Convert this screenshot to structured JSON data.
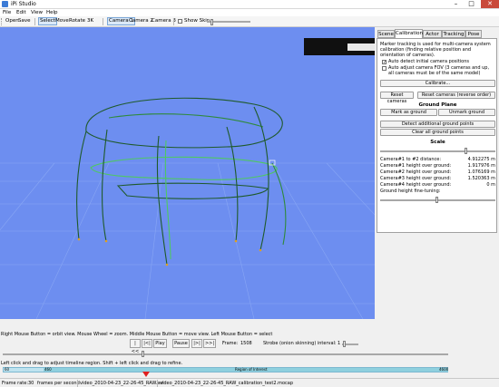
{
  "window": {
    "title": "iPi Studio",
    "minimize": "–",
    "maximize": "□",
    "close": "✕"
  },
  "menu": [
    "File",
    "Edit",
    "View",
    "Help"
  ],
  "toolbar": {
    "open": "Open",
    "save": "Save",
    "select": "Select",
    "move": "Move",
    "rotate": "Rotate",
    "zoom_value": "3K",
    "cameras": [
      "Camera 1",
      "Camera 2",
      "Camera 3"
    ],
    "show_skin": "Show Skin"
  },
  "tabs": [
    "Scene",
    "Calibration",
    "Actor",
    "Tracking",
    "Pose"
  ],
  "calibration": {
    "description": "Marker tracking is used for multi-camera system calibration (finding relative position and orientation of cameras).",
    "auto_detect": "Auto detect initial camera positions",
    "auto_adjust": "Auto adjust camera FOV (3 cameras and up, all cameras must be of the same model)",
    "calibrate_btn": "Calibrate...",
    "reset_cameras_btn": "Reset cameras",
    "reset_reverse_btn": "Reset cameras (reverse order)",
    "ground_plane_hdr": "Ground Plane",
    "mark_ground_btn": "Mark as ground",
    "unmark_ground_btn": "Unmark ground",
    "detect_ground_btn": "Detect additional ground points",
    "clear_ground_btn": "Clear all ground points",
    "scale_hdr": "Scale",
    "distance_label": "Camera#1 to #2 distance:",
    "distance_value": "4.912275 m",
    "h1_label": "Camera#1 height over ground:",
    "h1_value": "1.917976 m",
    "h2_label": "Camera#2 height over ground:",
    "h2_value": "1.076169 m",
    "h3_label": "Camera#3 height over ground:",
    "h3_value": "1.520363 m",
    "h4_label": "Camera#4 height over ground:",
    "h4_value": "0 m",
    "fine_tune_label": "Ground height fine-tuning:"
  },
  "bottom": {
    "mouse_help": "Right Mouse Button = orbit view. Mouse Wheel = zoom. Middle Mouse Button = move view. Left Mouse Button = select",
    "play_buttons": [
      "|<<",
      "|<|",
      "Play",
      "Pause",
      "|>|",
      ">>|"
    ],
    "frame_label": "Frame:",
    "frame_value": "1508",
    "strobe_label": "Strobe (onion skinning) interval:",
    "strobe_value": "1",
    "timeline_help": "Left click and drag to adjust timeline region. Shift + left click and drag to refine.",
    "tl_start": "60",
    "tl_region_start": "460",
    "tl_region_label": "Region of Interest",
    "tl_end": "4600",
    "playhead_progress": 0.325
  },
  "status": {
    "frame_rate_label": "Frame rate:",
    "frame_rate_value": "30",
    "fps_label": "frames per second",
    "file1": "video_2010-04-23_22-26-45_RAW.avi",
    "file2": "video_2010-04-23_22-26-45_RAW_calibration_test2.mocap"
  },
  "colors": {
    "viewport": "#6d8ef0",
    "grid": "#8aa6f4",
    "trail_dark": "#1f5a2a",
    "trail_light": "#4fc862",
    "playhead": "#e02020"
  }
}
